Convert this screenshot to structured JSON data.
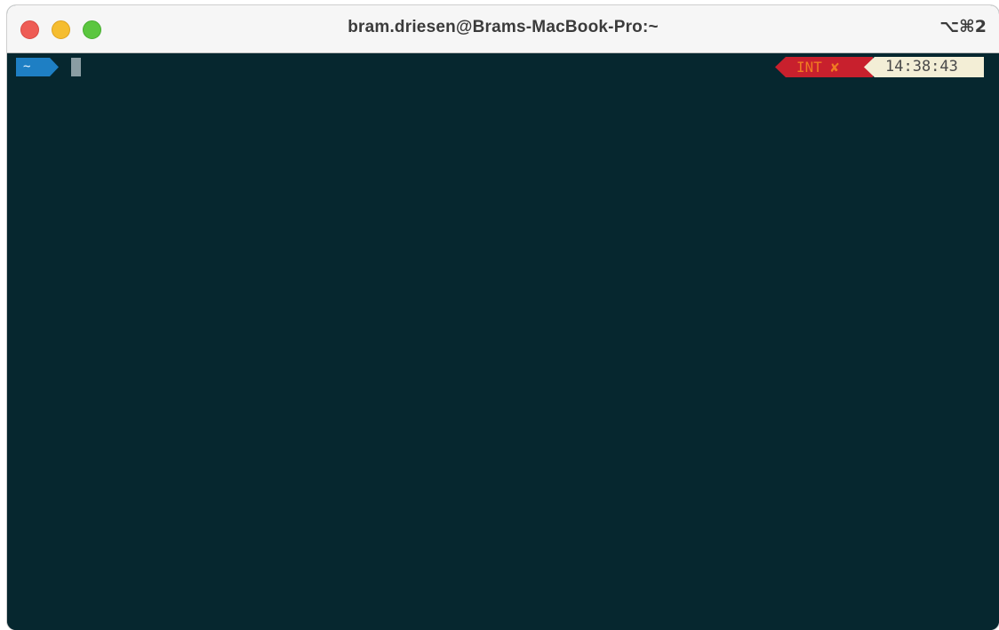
{
  "window": {
    "title": "bram.driesen@Brams-MacBook-Pro:~",
    "shortcut": "⌥⌘2"
  },
  "prompt": {
    "path": "~",
    "path_bg_color": "#1e7fc4"
  },
  "rprompt": {
    "status": "INT ✘",
    "status_bg_color": "#c8202d",
    "status_fg_color": "#f07b22",
    "time": "14:38:43",
    "time_bg_color": "#f3eed6"
  },
  "colors": {
    "terminal_bg": "#06272f",
    "titlebar_bg": "#f6f6f6"
  },
  "icons": {
    "close": "traffic-close-icon",
    "minimize": "traffic-minimize-icon",
    "maximize": "traffic-maximize-icon"
  }
}
